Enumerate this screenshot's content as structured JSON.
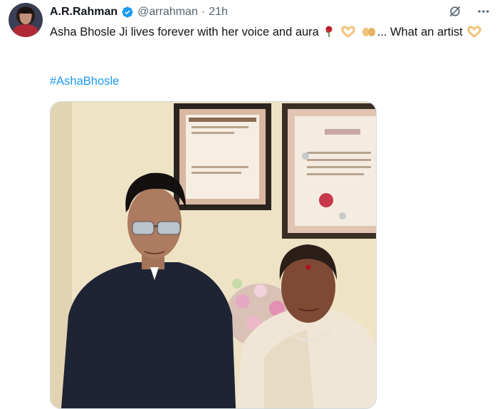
{
  "author": {
    "name": "A.R.Rahman",
    "handle": "@arrahman",
    "separator": "·",
    "time": "21h",
    "verified": true
  },
  "post": {
    "text_part1": "Asha Bhosle Ji lives forever with her voice and aura",
    "text_part2": "... What an artist",
    "hashtag": "#AshaBhosle"
  },
  "icons": {
    "avatar": "profile-photo",
    "verified": "verified-badge-icon",
    "grok": "grok-icon",
    "more": "more-options-icon",
    "emojis": [
      "rose-emoji",
      "heart-hands-emoji",
      "palms-up-emoji",
      "heart-hands-emoji"
    ]
  },
  "media": {
    "description_hidden": true
  },
  "colors": {
    "accent": "#1d9bf0",
    "secondary_text": "#536471",
    "primary_text": "#0f1419"
  }
}
